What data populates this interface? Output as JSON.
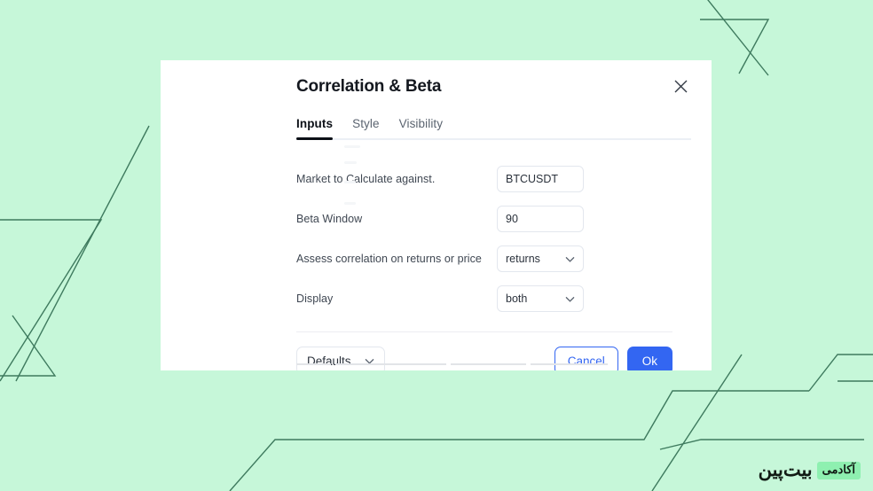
{
  "theme": {
    "page_background": "#c6f7d9",
    "line_color": "#3e7a5e",
    "dialog_background": "#ffffff",
    "accent_blue": "#3366f2",
    "active_tab_underline": "#0c1017",
    "watermark_badge_background": "#8ef0b0"
  },
  "dialog": {
    "title": "Correlation & Beta",
    "close_icon": "close-x-icon",
    "tabs": [
      {
        "label": "Inputs",
        "active": true
      },
      {
        "label": "Style",
        "active": false
      },
      {
        "label": "Visibility",
        "active": false
      }
    ],
    "form": {
      "rows": [
        {
          "label": "Market to Calculate against.",
          "control": "text",
          "value": "BTCUSDT"
        },
        {
          "label": "Beta Window",
          "control": "text",
          "value": "90"
        },
        {
          "label": "Assess correlation on returns or price",
          "control": "select",
          "value": "returns"
        },
        {
          "label": "Display",
          "control": "select",
          "value": "both"
        }
      ]
    },
    "footer": {
      "defaults_label": "Defaults",
      "defaults_icon": "chevron-down-icon",
      "cancel_label": "Cancel",
      "ok_label": "Ok"
    }
  },
  "watermark": {
    "badge_text": "آکادمی",
    "name_text": "بیت‌پین"
  }
}
